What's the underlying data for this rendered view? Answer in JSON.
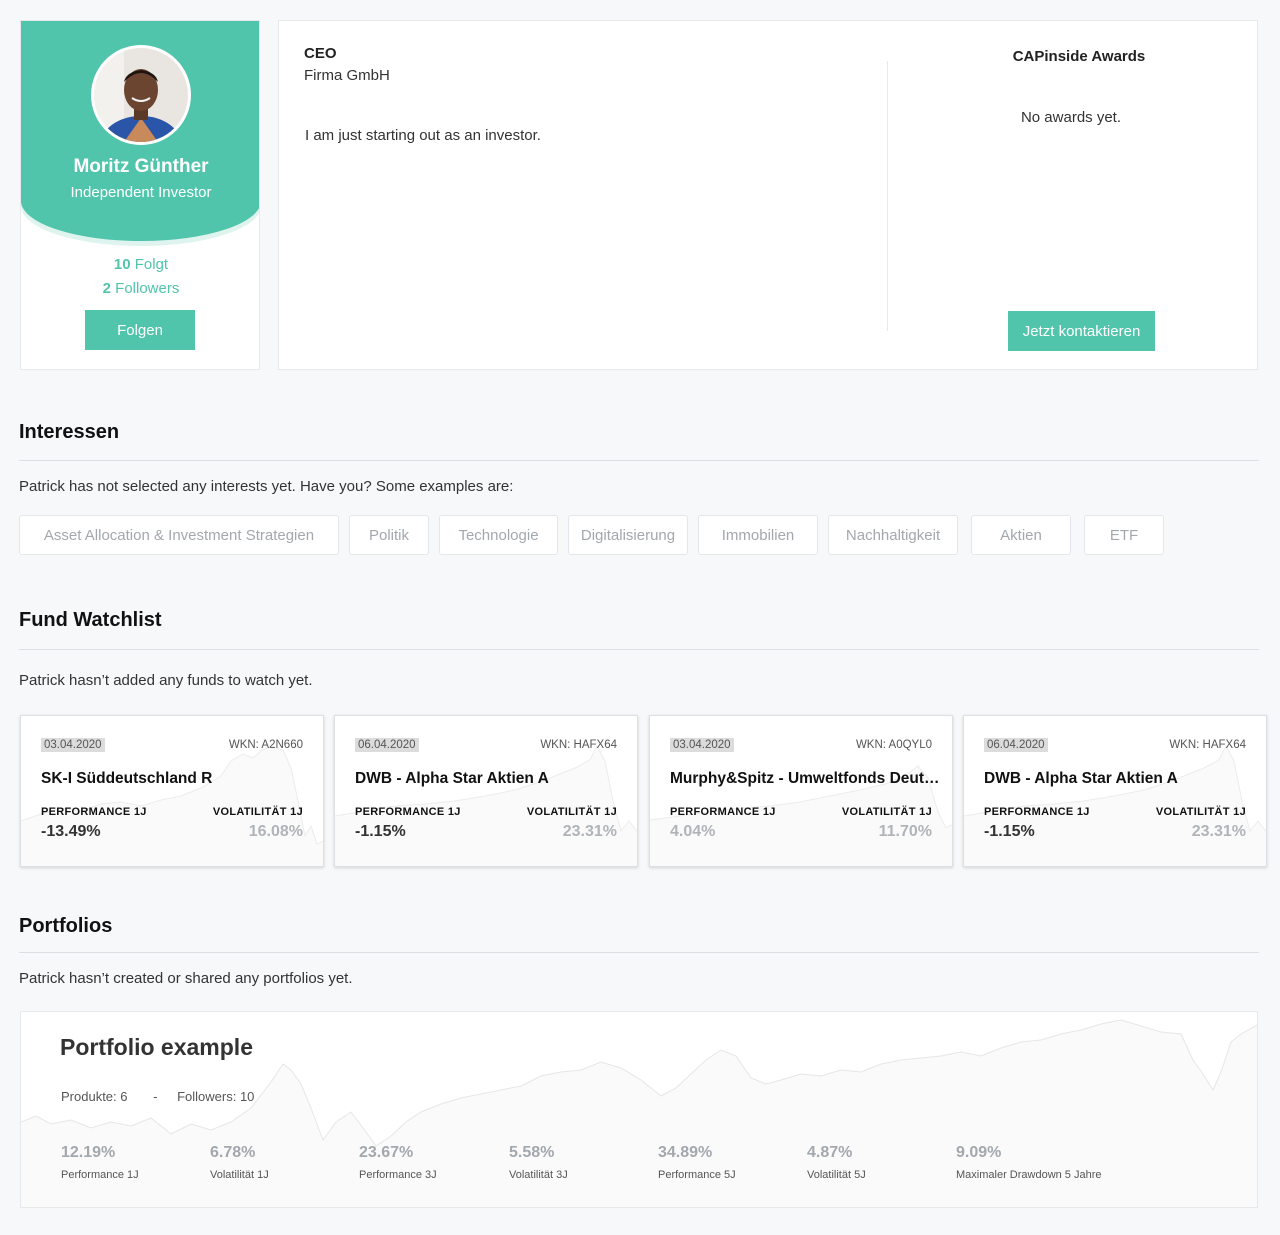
{
  "profile": {
    "name": "Moritz Günther",
    "role": "Independent Investor",
    "following_count": "10",
    "following_label": "Folgt",
    "followers_count": "2",
    "followers_label": "Followers",
    "follow_button": "Folgen"
  },
  "about": {
    "title": "CEO",
    "company": "Firma GmbH",
    "bio": "I am just starting out as an investor.",
    "awards_title": "CAPinside Awards",
    "awards_empty": "No awards yet.",
    "contact_button": "Jetzt kontaktieren"
  },
  "interests": {
    "title": "Interessen",
    "description": "Patrick has not selected any interests yet. Have you? Some examples are:",
    "tags": [
      "Asset Allocation & Investment Strategien",
      "Politik",
      "Technologie",
      "Digitalisierung",
      "Immobilien",
      "Nachhaltigkeit",
      "Aktien",
      "ETF"
    ]
  },
  "watchlist": {
    "title": "Fund Watchlist",
    "description": "Patrick hasn’t added any funds to watch yet.",
    "performance_label": "PERFORMANCE 1J",
    "volatility_label": "VOLATILITÄT 1J",
    "funds": [
      {
        "date": "03.04.2020",
        "wkn": "WKN: A2N660",
        "name": "SK-I Süddeutschland R",
        "performance": "-13.49%",
        "volatility": "16.08%",
        "perf_color": "#333333"
      },
      {
        "date": "06.04.2020",
        "wkn": "WKN: HAFX64",
        "name": "DWB - Alpha Star Aktien A",
        "performance": "-1.15%",
        "volatility": "23.31%",
        "perf_color": "#333333"
      },
      {
        "date": "03.04.2020",
        "wkn": "WKN: A0QYL0",
        "name": "Murphy&Spitz - Umweltfonds Deutschland",
        "performance": "4.04%",
        "volatility": "11.70%",
        "perf_color": "#b0b4b9"
      },
      {
        "date": "06.04.2020",
        "wkn": "WKN: HAFX64",
        "name": "DWB - Alpha Star Aktien A",
        "performance": "-1.15%",
        "volatility": "23.31%",
        "perf_color": "#333333"
      }
    ]
  },
  "portfolios": {
    "title": "Portfolios",
    "description": "Patrick hasn’t created or shared any portfolios yet.",
    "example": {
      "title": "Portfolio example",
      "products": "Produkte: 6",
      "separator": "-",
      "followers": "Followers: 10",
      "stats": [
        {
          "value": "12.19%",
          "label": "Performance 1J"
        },
        {
          "value": "6.78%",
          "label": "Volatilität 1J"
        },
        {
          "value": "23.67%",
          "label": "Performance 3J"
        },
        {
          "value": "5.58%",
          "label": "Volatilität 3J"
        },
        {
          "value": "34.89%",
          "label": "Performance 5J"
        },
        {
          "value": "4.87%",
          "label": "Volatilität 5J"
        },
        {
          "value": "9.09%",
          "label": "Maximaler Drawdown 5 Jahre"
        }
      ]
    }
  },
  "colors": {
    "accent": "#50c5ab",
    "muted": "#a3a8ae"
  }
}
